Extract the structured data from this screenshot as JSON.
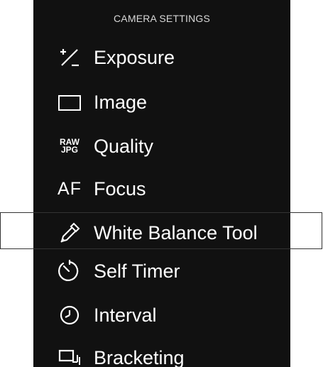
{
  "header": {
    "title": "CAMERA SETTINGS"
  },
  "menu": {
    "items": [
      {
        "label": "Exposure",
        "icon": "exposure-compensation-icon",
        "selected": false
      },
      {
        "label": "Image",
        "icon": "image-frame-icon",
        "selected": false
      },
      {
        "label": "Quality",
        "icon": "raw-jpg-icon",
        "selected": false,
        "icon_text_top": "RAW",
        "icon_text_bottom": "JPG"
      },
      {
        "label": "Focus",
        "icon": "af-icon",
        "selected": false,
        "icon_text": "AF"
      },
      {
        "label": "White Balance Tool",
        "icon": "eyedropper-icon",
        "selected": true
      },
      {
        "label": "Self Timer",
        "icon": "self-timer-icon",
        "selected": false
      },
      {
        "label": "Interval",
        "icon": "interval-clock-icon",
        "selected": false
      },
      {
        "label": "Bracketing",
        "icon": "bracketing-icon",
        "selected": false
      }
    ]
  },
  "colors": {
    "panel_background": "#111111",
    "text": "#ffffff",
    "header_text": "#d8d8d8",
    "selection_border": "#333333"
  }
}
